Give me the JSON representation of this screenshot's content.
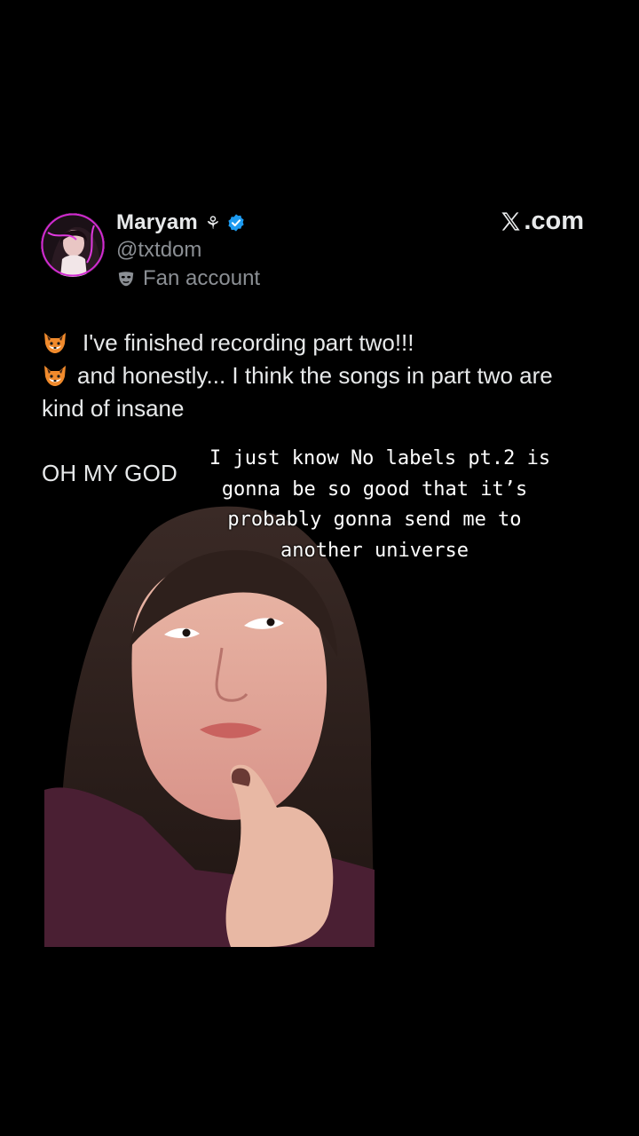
{
  "tweet": {
    "display_name": "Maryam",
    "name_glyph": "⚘",
    "handle": "@txtdom",
    "account_label": "Fan account",
    "lines": [
      "I've finished recording part two!!!",
      "and honestly... I think the songs in part two are",
      "kind of insane"
    ],
    "exclamation": "OH MY GOD",
    "icons": {
      "avatar": "profile-photo",
      "verified": "verified-badge-icon",
      "label": "mask-icon",
      "line_emoji": "fox-emoji-icon"
    }
  },
  "brand": {
    "site_label": ".com",
    "logo_icon": "x-logo-icon"
  },
  "caption": {
    "lines": [
      "I just know No labels pt.2 is",
      "gonna be so good that it’s",
      "probably gonna send me to",
      "another universe"
    ]
  },
  "colors": {
    "background": "#000000",
    "text_primary": "#e7e9ea",
    "text_secondary": "#8b8f94",
    "verified_blue": "#1d9bf0",
    "avatar_ring": "#d22bd2"
  }
}
